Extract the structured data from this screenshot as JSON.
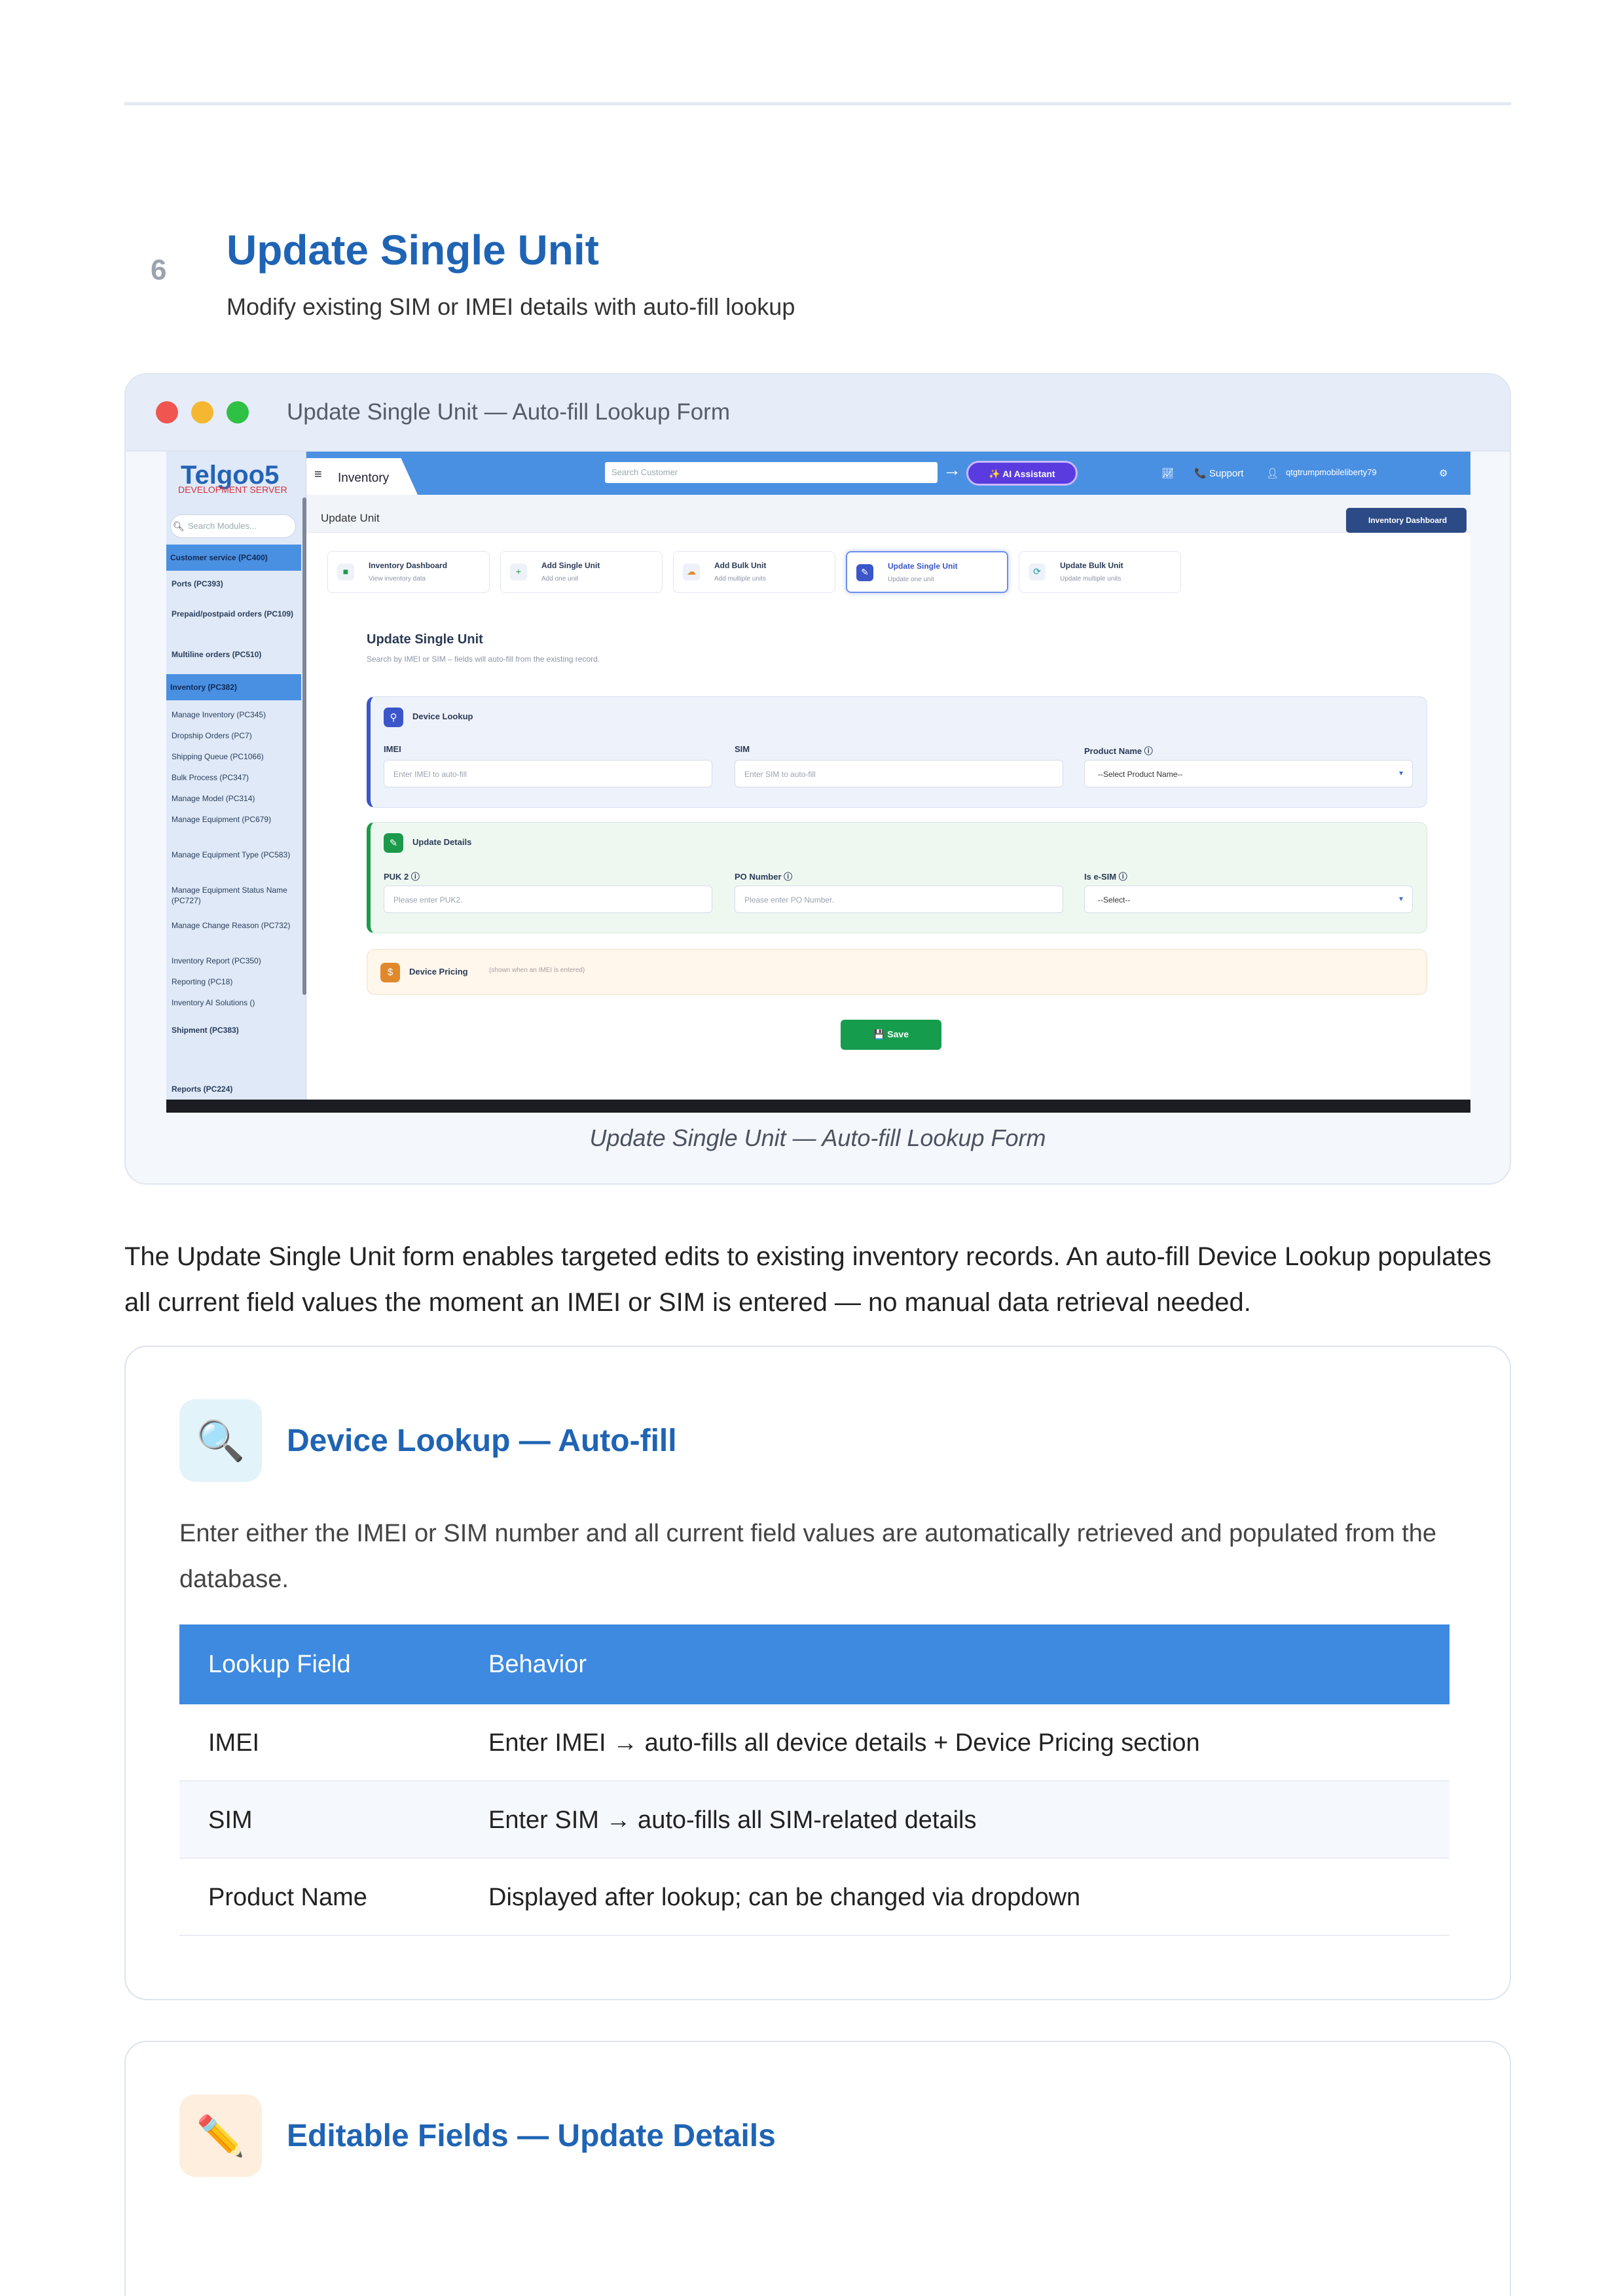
{
  "section": {
    "number": "6",
    "title": "Update Single Unit",
    "subtitle": "Modify existing SIM or IMEI details with auto-fill lookup"
  },
  "window": {
    "title": "Update Single Unit — Auto-fill Lookup Form",
    "caption": "Update Single Unit — Auto-fill Lookup Form"
  },
  "app": {
    "logo": "Telgoo5",
    "logo_sub": "DEVELOPMENT SERVER",
    "side_search_placeholder": "Search Modules...",
    "sidebar": [
      {
        "label": "Customer service (PC400)"
      },
      {
        "label": "Ports (PC393)"
      },
      {
        "label": "Prepaid/postpaid orders (PC109)"
      },
      {
        "label": "Multiline orders (PC510)"
      },
      {
        "label": "Inventory (PC382)"
      },
      {
        "label": "Manage Inventory (PC345)"
      },
      {
        "label": "Dropship Orders (PC7)"
      },
      {
        "label": "Shipping Queue (PC1066)"
      },
      {
        "label": "Bulk Process (PC347)"
      },
      {
        "label": "Manage Model (PC314)"
      },
      {
        "label": "Manage Equipment (PC679)"
      },
      {
        "label": "Manage Equipment Type (PC583)"
      },
      {
        "label": "Manage Equipment Status Name (PC727)"
      },
      {
        "label": "Manage Change Reason (PC732)"
      },
      {
        "label": "Inventory Report (PC350)"
      },
      {
        "label": "Reporting (PC18)"
      },
      {
        "label": "Inventory AI Solutions ()"
      },
      {
        "label": "Shipment (PC383)"
      },
      {
        "label": "Reports (PC224)"
      }
    ],
    "top_tab": "Inventory",
    "search_placeholder": "Search Customer",
    "ai_button": "✨ AI Assistant",
    "support": "📞 Support",
    "user": "qtgtrumpmobileliberty79",
    "breadcrumb": "Update Unit",
    "dashboard_button": "Inventory Dashboard",
    "tabs": [
      {
        "title": "Inventory Dashboard",
        "sub": "View inventory data",
        "icon": "■"
      },
      {
        "title": "Add Single Unit",
        "sub": "Add one unit",
        "icon": "+"
      },
      {
        "title": "Add Bulk Unit",
        "sub": "Add multiple units",
        "icon": "☁"
      },
      {
        "title": "Update Single Unit",
        "sub": "Update one unit",
        "icon": "✎"
      },
      {
        "title": "Update Bulk Unit",
        "sub": "Update multiple units",
        "icon": "⟳"
      }
    ],
    "form_title": "Update Single Unit",
    "form_sub": "Search by IMEI or SIM – fields will auto-fill from the existing record.",
    "lookup": {
      "title": "Device Lookup",
      "imei_label": "IMEI",
      "imei_placeholder": "Enter IMEI to auto-fill",
      "sim_label": "SIM",
      "sim_placeholder": "Enter SIM to auto-fill",
      "product_label": "Product Name ⓘ",
      "product_value": "--Select Product Name--"
    },
    "details": {
      "title": "Update Details",
      "puk_label": "PUK 2 ⓘ",
      "puk_placeholder": "Please enter PUK2.",
      "po_label": "PO Number ⓘ",
      "po_placeholder": "Please enter PO Number.",
      "esim_label": "Is e-SIM ⓘ",
      "esim_value": "--Select--"
    },
    "pricing": {
      "title": "Device Pricing",
      "note": "(shown when an IMEI is entered)"
    },
    "save_button": "💾 Save"
  },
  "paragraph": "The Update Single Unit form enables targeted edits to existing inventory records. An auto-fill Device Lookup populates all current field values the moment an IMEI or SIM is entered — no manual data retrieval needed.",
  "card1": {
    "icon": "🔍",
    "title": "Device Lookup — Auto-fill",
    "desc": "Enter either the IMEI or SIM number and all current field values are automatically retrieved and populated from the database.",
    "table": {
      "headers": [
        "Lookup Field",
        "Behavior"
      ],
      "rows": [
        [
          "IMEI",
          "Enter IMEI → auto-fills all device details + Device Pricing section"
        ],
        [
          "SIM",
          "Enter SIM → auto-fills all SIM-related details"
        ],
        [
          "Product Name",
          "Displayed after lookup; can be changed via dropdown"
        ]
      ]
    }
  },
  "card2": {
    "icon": "✏️",
    "title": "Editable Fields — Update Details"
  }
}
